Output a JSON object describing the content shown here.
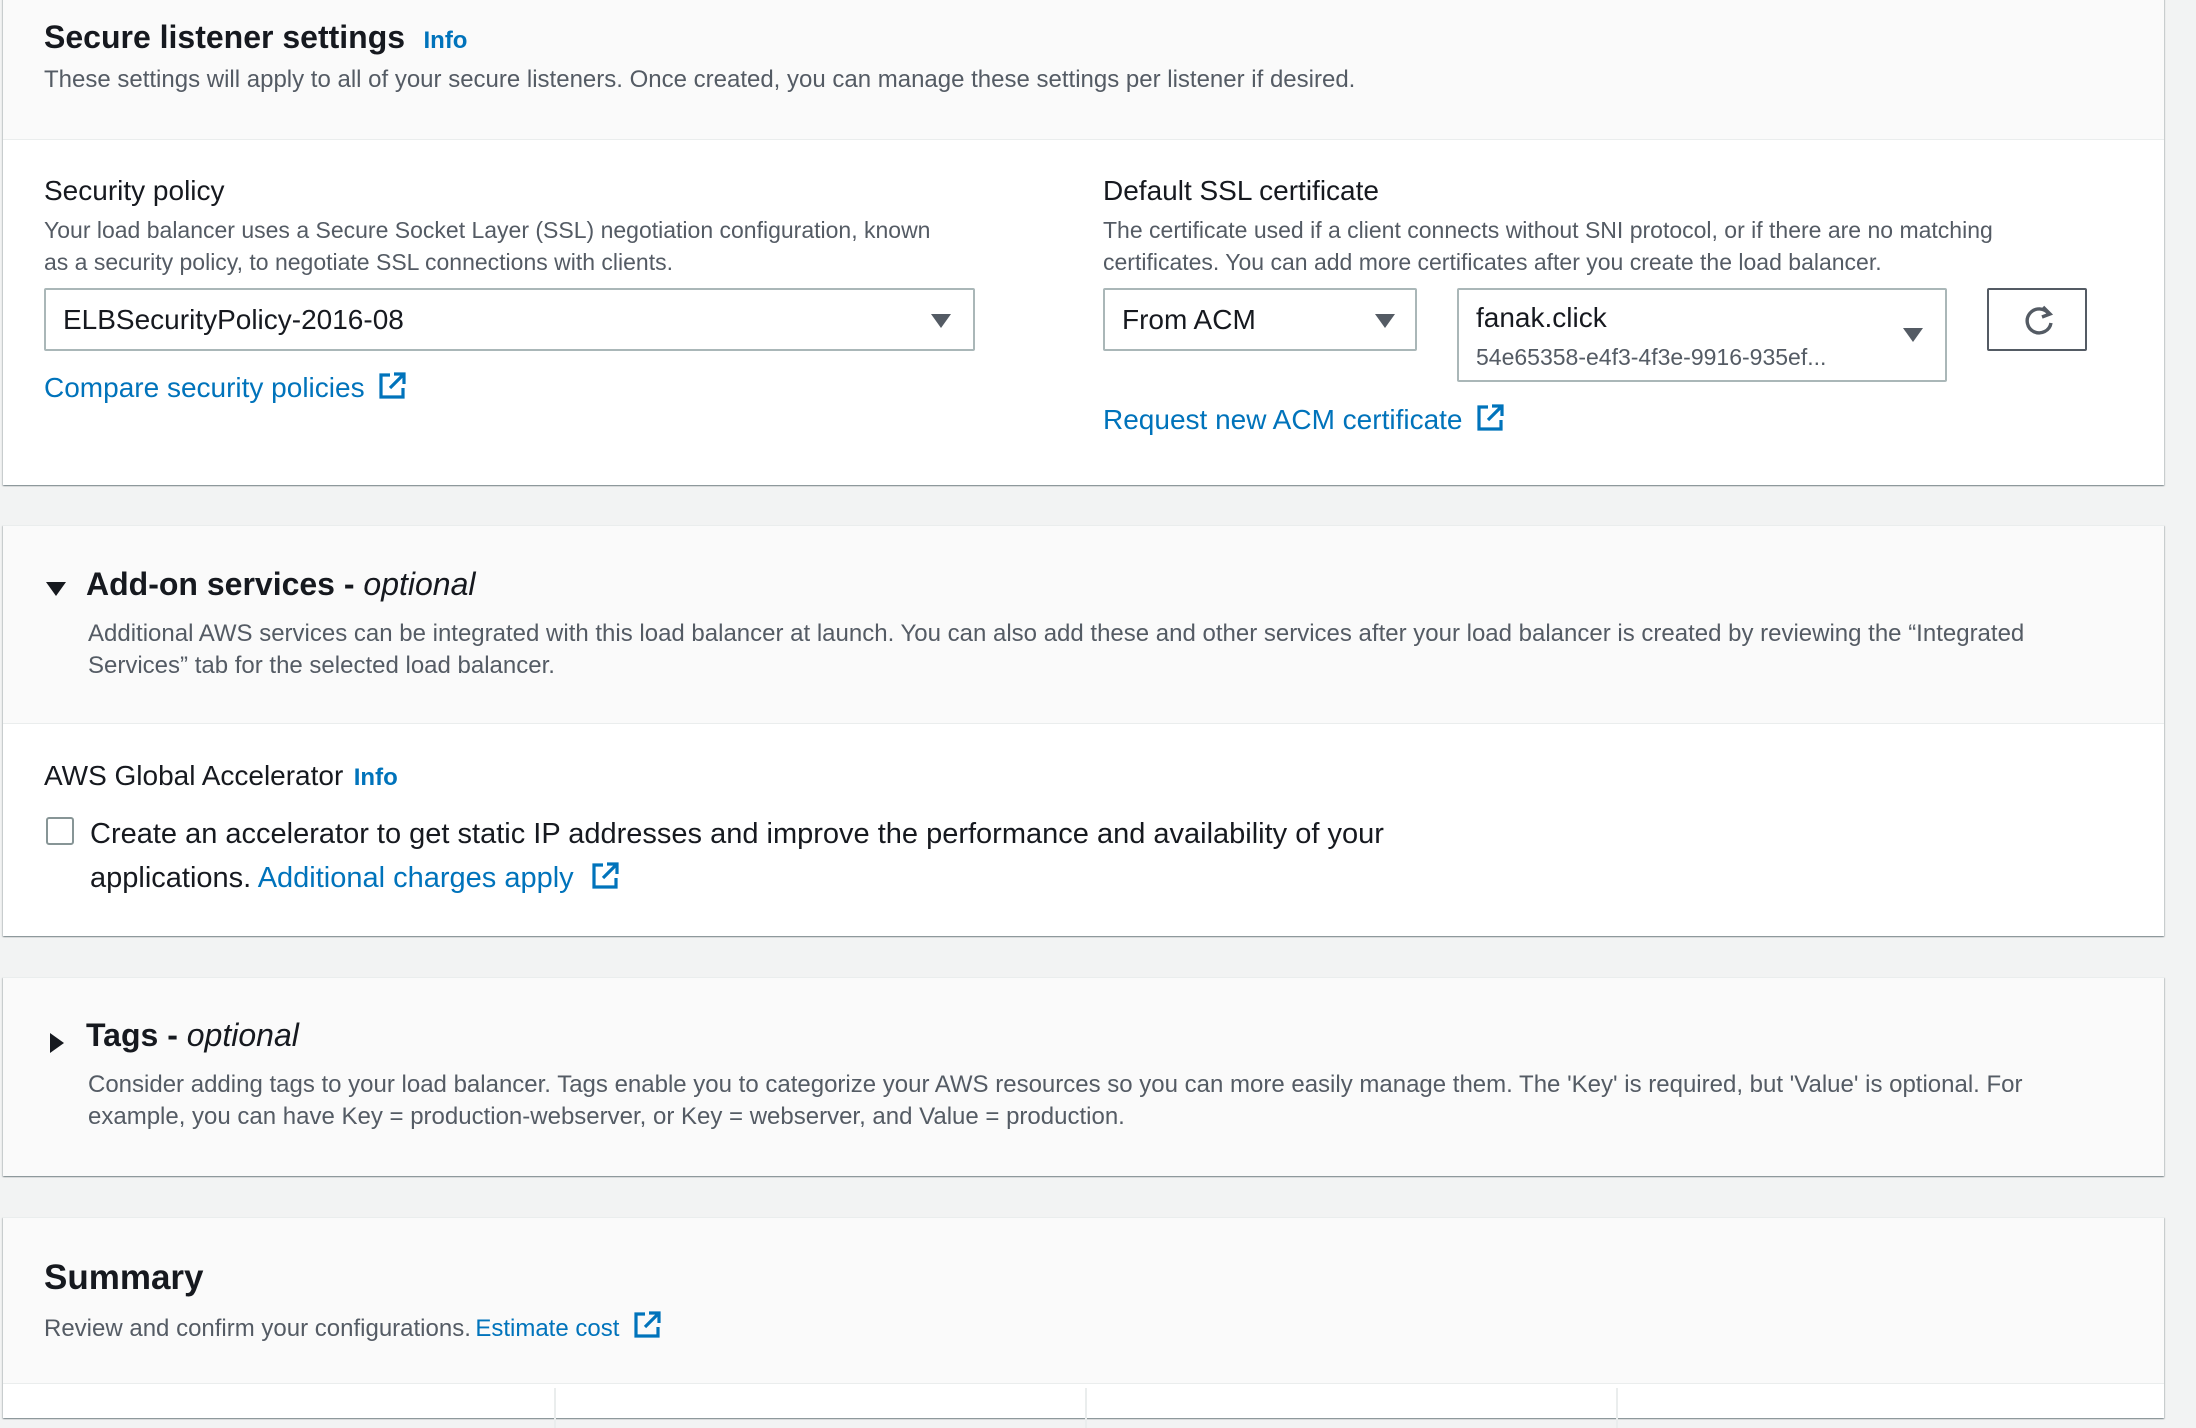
{
  "secure": {
    "title": "Secure listener settings",
    "info": "Info",
    "description": "These settings will apply to all of your secure listeners. Once created, you can manage these settings per listener if desired.",
    "security_policy": {
      "label": "Security policy",
      "description_line1": "Your load balancer uses a Secure Socket Layer (SSL) negotiation configuration, known",
      "description_line2": "as a security policy, to negotiate SSL connections with clients.",
      "selected": "ELBSecurityPolicy-2016-08",
      "compare_link": "Compare security policies"
    },
    "ssl_cert": {
      "label": "Default SSL certificate",
      "description_line1": "The certificate used if a client connects without SNI protocol, or if there are no matching",
      "description_line2": "certificates. You can add more certificates after you create the load balancer.",
      "source_selected": "From ACM",
      "cert_name": "fanak.click",
      "cert_id": "54e65358-e4f3-4f3e-9916-935ef...",
      "request_link": "Request new ACM certificate"
    }
  },
  "addon": {
    "title": "Add-on services - ",
    "title_optional": "optional",
    "description_line1": "Additional AWS services can be integrated with this load balancer at launch. You can also add these and other services after your load balancer is created by reviewing the “Integrated",
    "description_line2": "Services” tab for the selected load balancer.",
    "accelerator": {
      "label": "AWS Global Accelerator",
      "info": "Info",
      "checkbox_line1": "Create an accelerator to get static IP addresses and improve the performance and availability of your",
      "checkbox_line2": "applications.",
      "charges_link": "Additional charges apply",
      "checked": false
    }
  },
  "tags": {
    "title": "Tags - ",
    "title_optional": "optional",
    "description_line1": "Consider adding tags to your load balancer. Tags enable you to categorize your AWS resources so you can more easily manage them. The 'Key' is required, but 'Value' is optional. For",
    "description_line2": "example, you can have Key = production-webserver, or Key = webserver, and Value = production."
  },
  "summary": {
    "title": "Summary",
    "description": "Review and confirm your configurations.",
    "estimate_link": "Estimate cost"
  },
  "colors": {
    "link": "#0073bb",
    "text": "#16191f",
    "muted": "#545b64",
    "bg": "#f2f3f3"
  },
  "icons": [
    "external-link-icon",
    "refresh-icon",
    "caret-down-icon",
    "expand-caret-icon",
    "collapse-caret-icon",
    "checkbox-icon"
  ]
}
